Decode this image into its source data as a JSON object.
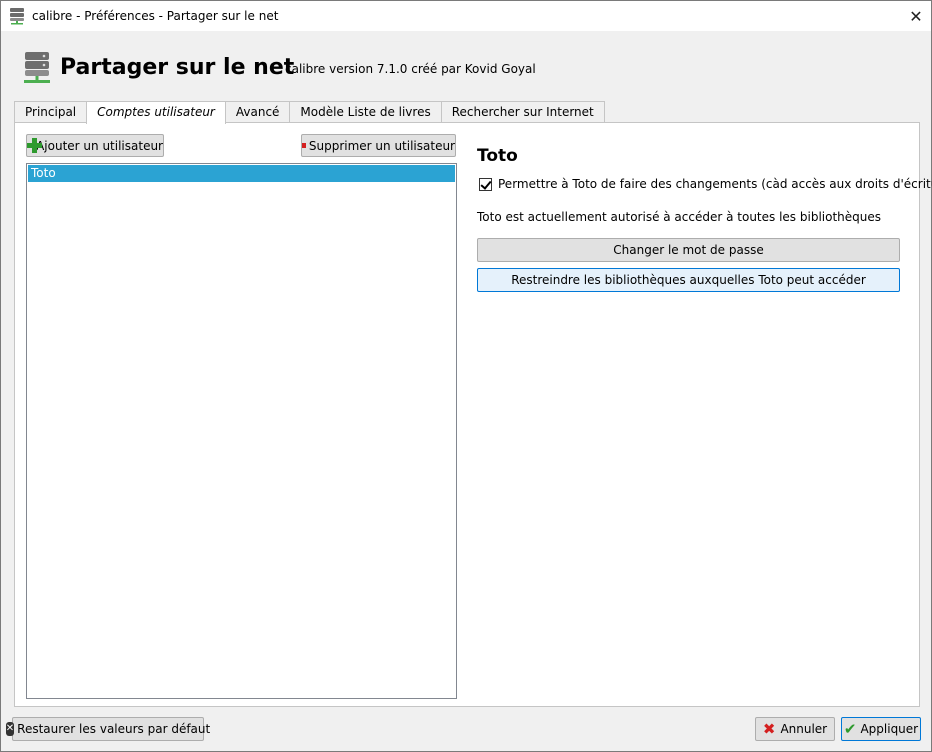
{
  "window": {
    "title": "calibre - Préférences - Partager sur le net",
    "close_glyph": "✕"
  },
  "header": {
    "heading": "Partager sur le net",
    "version": "calibre version 7.1.0 créé par Kovid Goyal",
    "icon": "server-icon"
  },
  "tabs": [
    {
      "label": "Principal",
      "active": false
    },
    {
      "label": "Comptes utilisateur",
      "active": true
    },
    {
      "label": "Avancé",
      "active": false
    },
    {
      "label": "Modèle Liste de livres",
      "active": false
    },
    {
      "label": "Rechercher sur Internet",
      "active": false
    }
  ],
  "users_panel": {
    "add_label": "Ajouter un utilisateur",
    "remove_label": "Supprimer un utilisateur",
    "users": [
      "Toto"
    ],
    "selected_index": 0
  },
  "user_details": {
    "name": "Toto",
    "permission_label": "Permettre à  Toto de faire des changements (càd accès aux droits d'écriture)",
    "permission_checked": true,
    "access_text": "Toto est actuellement autorisé à accéder à toutes les bibliothèques",
    "change_password_label": "Changer le mot de passe",
    "restrict_label": "Restreindre les bibliothèques auxquelles Toto peut accéder"
  },
  "footer": {
    "restore_label": "Restaurer les valeurs par défaut",
    "cancel_label": "Annuler",
    "apply_label": "Appliquer"
  },
  "colors": {
    "selection": "#2ba3d3",
    "add_icon": "#2e9a2e",
    "remove_icon": "#d42020"
  }
}
